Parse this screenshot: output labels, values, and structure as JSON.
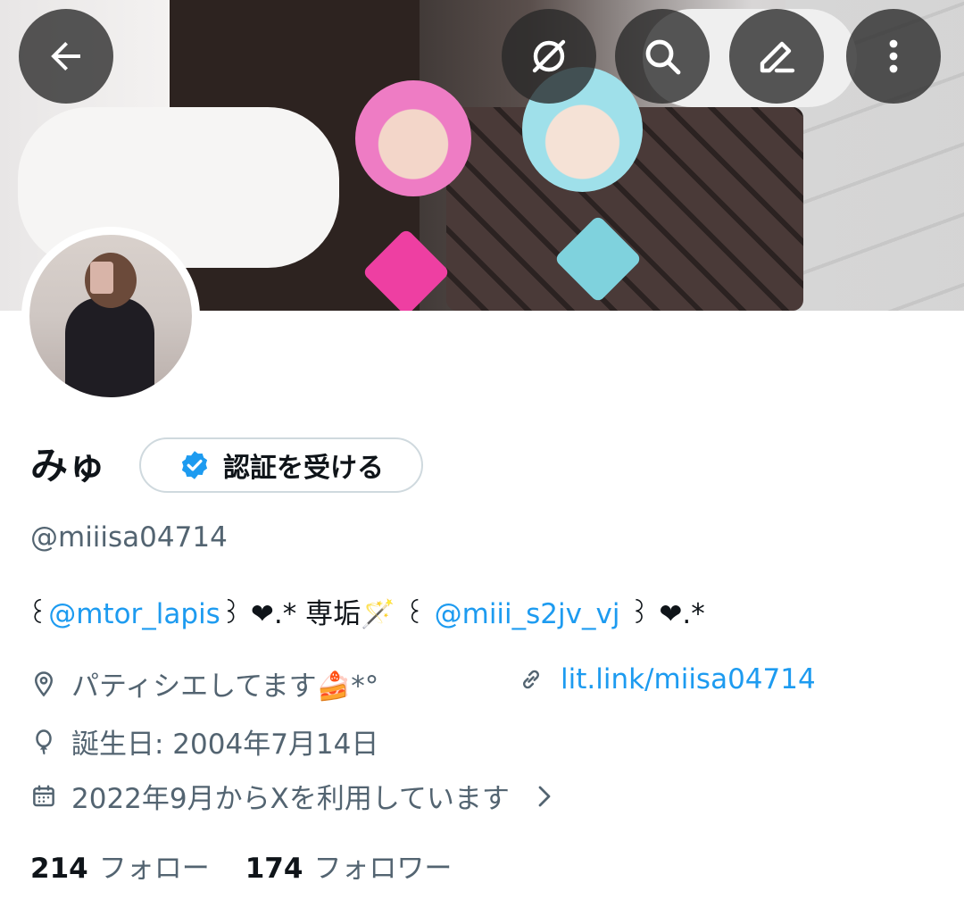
{
  "profile": {
    "display_name": "みゅ",
    "verify_button_label": "認証を受ける",
    "handle": "@miiisa04714",
    "bio": {
      "part1": "꒰",
      "mention1": "@mtor_lapis",
      "part2": "꒱ ❤︎.* 専垢🪄 ꒰ ",
      "mention2": "@miii_s2jv_vj",
      "part3": " ꒱ ❤︎.*"
    },
    "location": "パティシエしてます🍰*°",
    "website": "lit.link/miisa04714",
    "birthday": "誕生日: 2004年7月14日",
    "joined": "2022年9月からXを利用しています"
  },
  "stats": {
    "following_count": "214",
    "following_label": "フォロー",
    "followers_count": "174",
    "followers_label": "フォロワー"
  },
  "icons": {
    "back": "arrow-left-icon",
    "grok": "grok-icon",
    "search": "search-icon",
    "edit": "edit-icon",
    "more": "more-vertical-icon",
    "verified": "verified-badge-icon",
    "location": "location-pin-icon",
    "link": "link-icon",
    "birthday": "balloon-icon",
    "calendar": "calendar-icon",
    "chevron": "chevron-right-icon"
  },
  "colors": {
    "accent": "#1d9bf0",
    "secondary_text": "#536471",
    "primary_text": "#0f1419"
  }
}
